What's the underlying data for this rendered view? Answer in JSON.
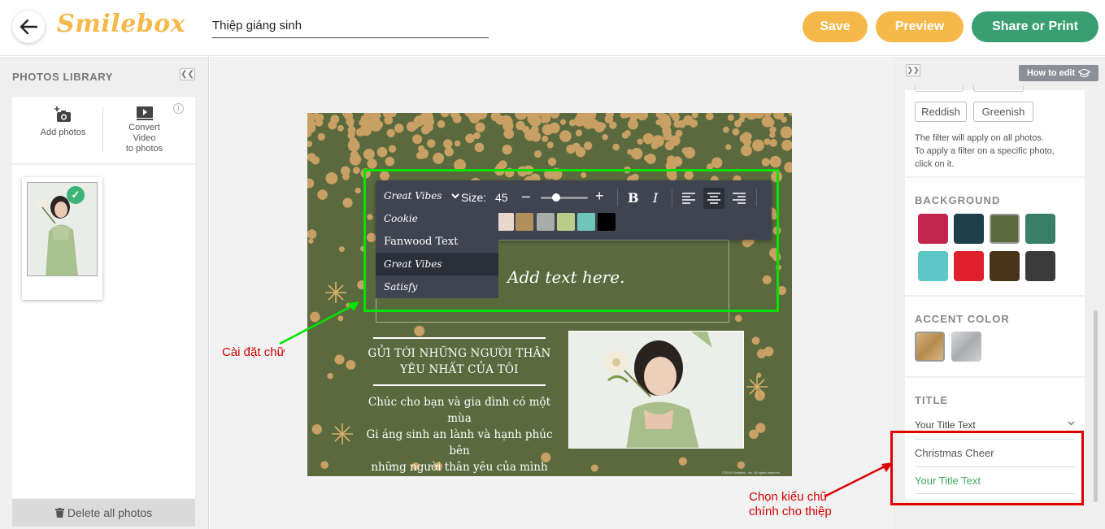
{
  "header": {
    "logo": "Smilebox",
    "card_title_value": "Thiệp giáng sinh",
    "save_label": "Save",
    "preview_label": "Preview",
    "share_label": "Share or Print"
  },
  "left_panel": {
    "title": "PHOTOS LIBRARY",
    "add_photos_label": "Add photos",
    "convert_video_label_1": "Convert",
    "convert_video_label_2": "Video",
    "convert_video_label_3": "to photos",
    "delete_all_label": "Delete all photos"
  },
  "card": {
    "text_placeholder": "Add text here.",
    "greeting_title_1": "GỬI TỚI NHỮNG NGƯỜI THÂN",
    "greeting_title_2": "YÊU NHẤT CỦA TÔI",
    "greeting_body_1": "Chúc cho bạn và gia đình có một mùa",
    "greeting_body_2": "Gi áng sinh an lành và hạnh phúc bên",
    "greeting_body_3": "những người thân yêu của mình nhé!",
    "copyright": "©2019 Smilebox, Inc. All rights reserved.",
    "background_color": "#5a6a3e",
    "dot_color": "#c9a064"
  },
  "toolbar": {
    "font_current": "Great Vibes",
    "size_label": "Size:",
    "size_value": "45",
    "minus": "–",
    "plus": "+",
    "bold": "B",
    "italic": "I",
    "swatches": [
      "#e8d8cc",
      "#b08f5c",
      "#a9ada9",
      "#b9cc8a",
      "#6fc5b9",
      "#000000"
    ]
  },
  "font_dropdown": {
    "options": [
      "Cookie",
      "Fanwood Text",
      "Great Vibes",
      "Satisfy"
    ],
    "selected": "Great Vibes"
  },
  "annotations": {
    "left_note": "Cài đặt chữ",
    "right_note_1": "Chọn kiểu chữ",
    "right_note_2": "chính cho thiệp"
  },
  "right_panel": {
    "how_to_edit": "How to edit",
    "filters": [
      "Reddish",
      "Greenish"
    ],
    "filter_note_1": "The filter will apply on all photos.",
    "filter_note_2": "To apply a filter on a specific photo,",
    "filter_note_3": "click on it.",
    "background_heading": "BACKGROUND",
    "background_colors": [
      "#c2264e",
      "#1e3f4b",
      "#5a6a3e",
      "#3a7f68",
      "#5ec7c6",
      "#e0212b",
      "#4a3319",
      "#3b3b3b"
    ],
    "background_selected": "#5a6a3e",
    "accent_heading": "ACCENT COLOR",
    "accent_colors": [
      "#c9a064",
      "#b5b7ba"
    ],
    "title_heading": "TITLE",
    "title_current": "Your Title Text",
    "title_options": [
      "Christmas Cheer",
      "Your Title Text"
    ],
    "title_option_colors": [
      "#555555",
      "#3fae5d"
    ]
  }
}
